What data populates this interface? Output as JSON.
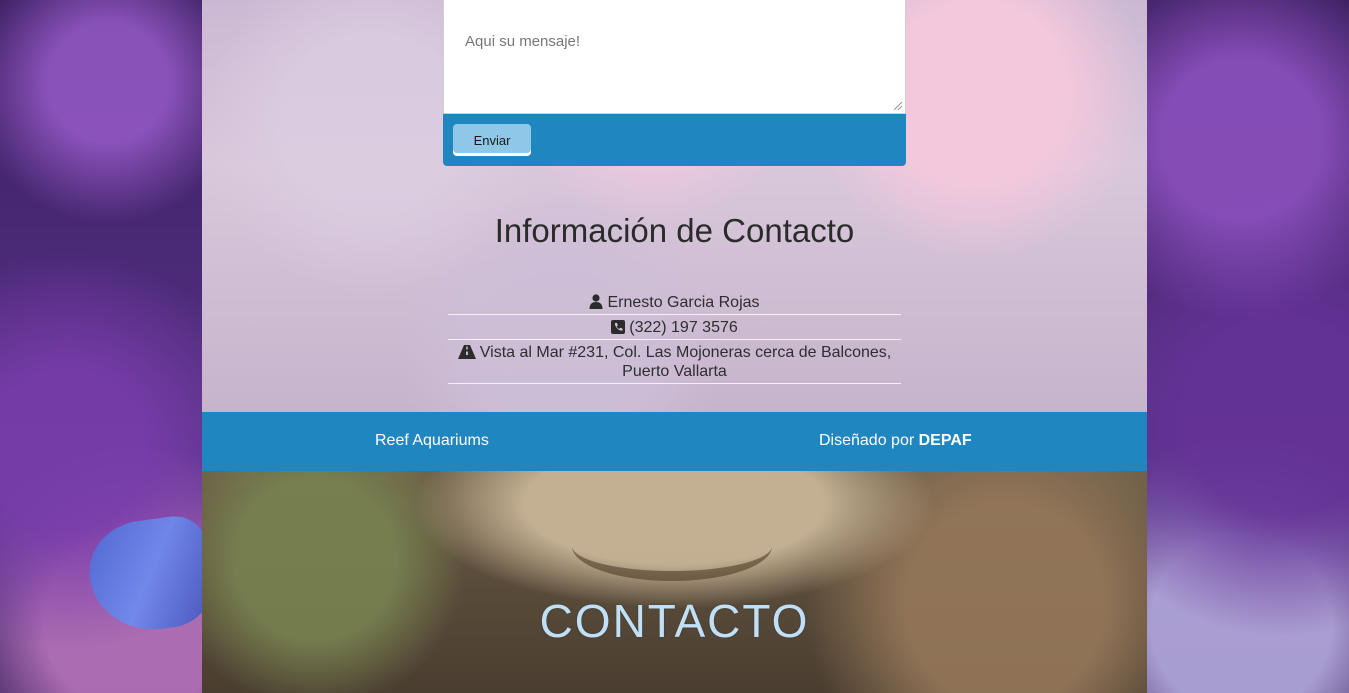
{
  "form": {
    "message_placeholder": "Aqui su mensaje!",
    "send_label": "Enviar"
  },
  "contact_info": {
    "title": "Información de Contacto",
    "items": [
      {
        "icon": "user-icon",
        "text": "Ernesto Garcia Rojas"
      },
      {
        "icon": "phone-icon",
        "text": "(322) 197 3576"
      },
      {
        "icon": "road-icon",
        "text": "Vista al Mar #231, Col. Las Mojoneras cerca de Balcones, Puerto Vallarta"
      }
    ]
  },
  "footer": {
    "site_name": "Reef Aquariums",
    "credit_prefix": "Diseñado por",
    "credit_brand": "DEPAF"
  },
  "hero": {
    "title": "CONTACTO"
  },
  "colors": {
    "accent_blue": "#1f86c0",
    "button_light_blue": "#8ec8e8"
  }
}
